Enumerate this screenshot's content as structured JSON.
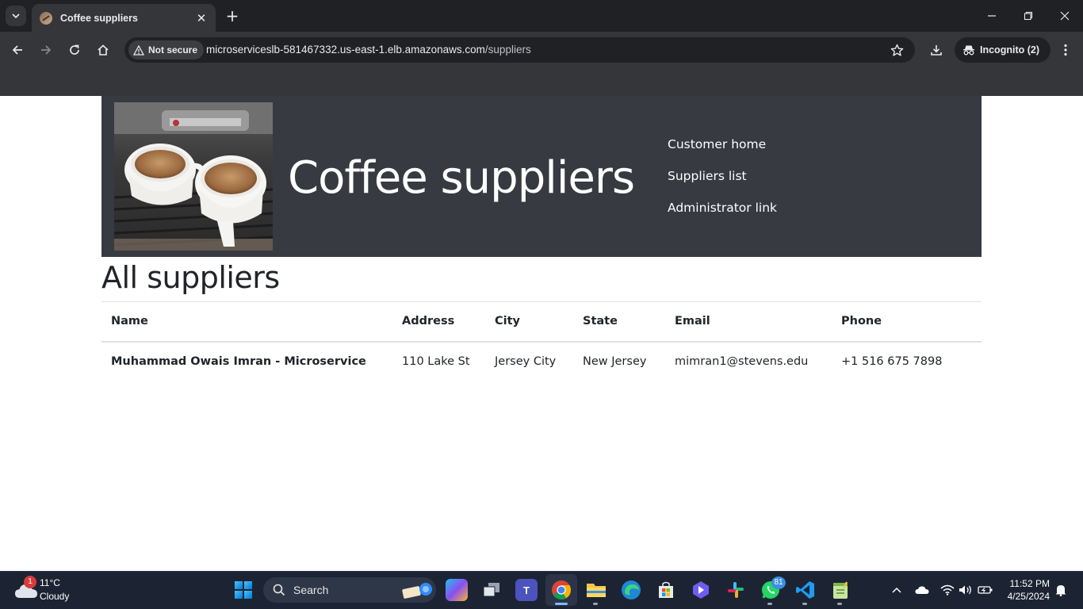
{
  "browser": {
    "tab_title": "Coffee suppliers",
    "security_label": "Not secure",
    "url_host": "microserviceslb-581467332.us-east-1.elb.amazonaws.com",
    "url_path": "/suppliers",
    "incognito_label": "Incognito (2)",
    "icons": [
      "tab-search-icon",
      "close-icon",
      "plus-icon",
      "minimize-icon",
      "restore-icon",
      "window-close-icon",
      "back-arrow-icon",
      "forward-arrow-icon",
      "reload-icon",
      "home-icon",
      "warning-icon",
      "star-icon",
      "download-icon",
      "incognito-icon",
      "more-vert-icon"
    ]
  },
  "site": {
    "title": "Coffee suppliers",
    "nav": [
      {
        "label": "Customer home"
      },
      {
        "label": "Suppliers list"
      },
      {
        "label": "Administrator link"
      }
    ],
    "header_bg": "#373a41"
  },
  "main": {
    "heading": "All suppliers",
    "table": {
      "columns": [
        "Name",
        "Address",
        "City",
        "State",
        "Email",
        "Phone"
      ],
      "rows": [
        {
          "name": "Muhammad Owais Imran - Microservice",
          "address": "110 Lake St",
          "city": "Jersey City",
          "state": "New Jersey",
          "email": "mimran1@stevens.edu",
          "phone": "+1 516 675 7898"
        }
      ]
    }
  },
  "taskbar": {
    "weather_temp": "11°C",
    "weather_desc": "Cloudy",
    "weather_badge": "1",
    "search_placeholder": "Search",
    "whatsapp_badge": "81",
    "time": "11:52 PM",
    "date": "4/25/2024",
    "apps": [
      "copilot-icon",
      "task-view-icon",
      "teams-icon",
      "chrome-icon",
      "file-explorer-icon",
      "edge-icon",
      "store-icon",
      "app-icon",
      "slack-icon",
      "whatsapp-icon",
      "vscode-icon",
      "notepad-icon"
    ]
  }
}
